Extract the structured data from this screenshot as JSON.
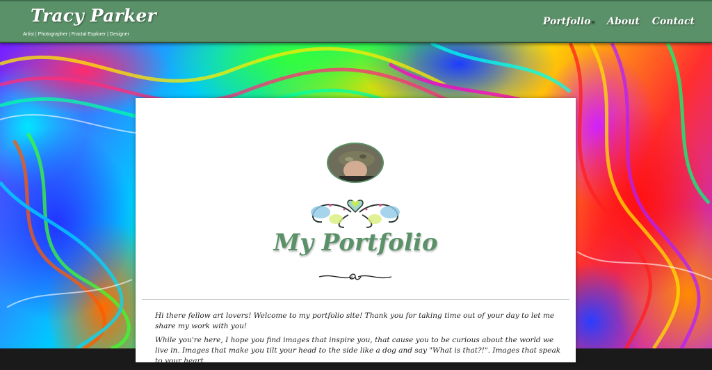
{
  "header": {
    "site_title": "Tracy Parker",
    "tagline": "Artist | Photographer | Fractal Explorer | Designer",
    "nav": {
      "portfolio": "Portfolio",
      "about": "About",
      "contact": "Contact"
    }
  },
  "main": {
    "heading": "My Portfolio",
    "intro_paragraphs": [
      "Hi there fellow art lovers! Welcome to my portfolio site! Thank you for taking time out of your day to let me share my work with you!",
      "While you're here, I hope you find images that inspire you, that cause you to be curious about the world we live in. Images that make you tilt your head to the side like a dog and say \"What is that?!\". Images that speak to your heart."
    ]
  },
  "colors": {
    "accent_green": "#5a9168",
    "card_background": "#ffffff"
  },
  "icons": {
    "nav_dropdown": "caret-down-icon",
    "ornament": "heart-swirl-ornament",
    "divider": "flourish-divider"
  }
}
